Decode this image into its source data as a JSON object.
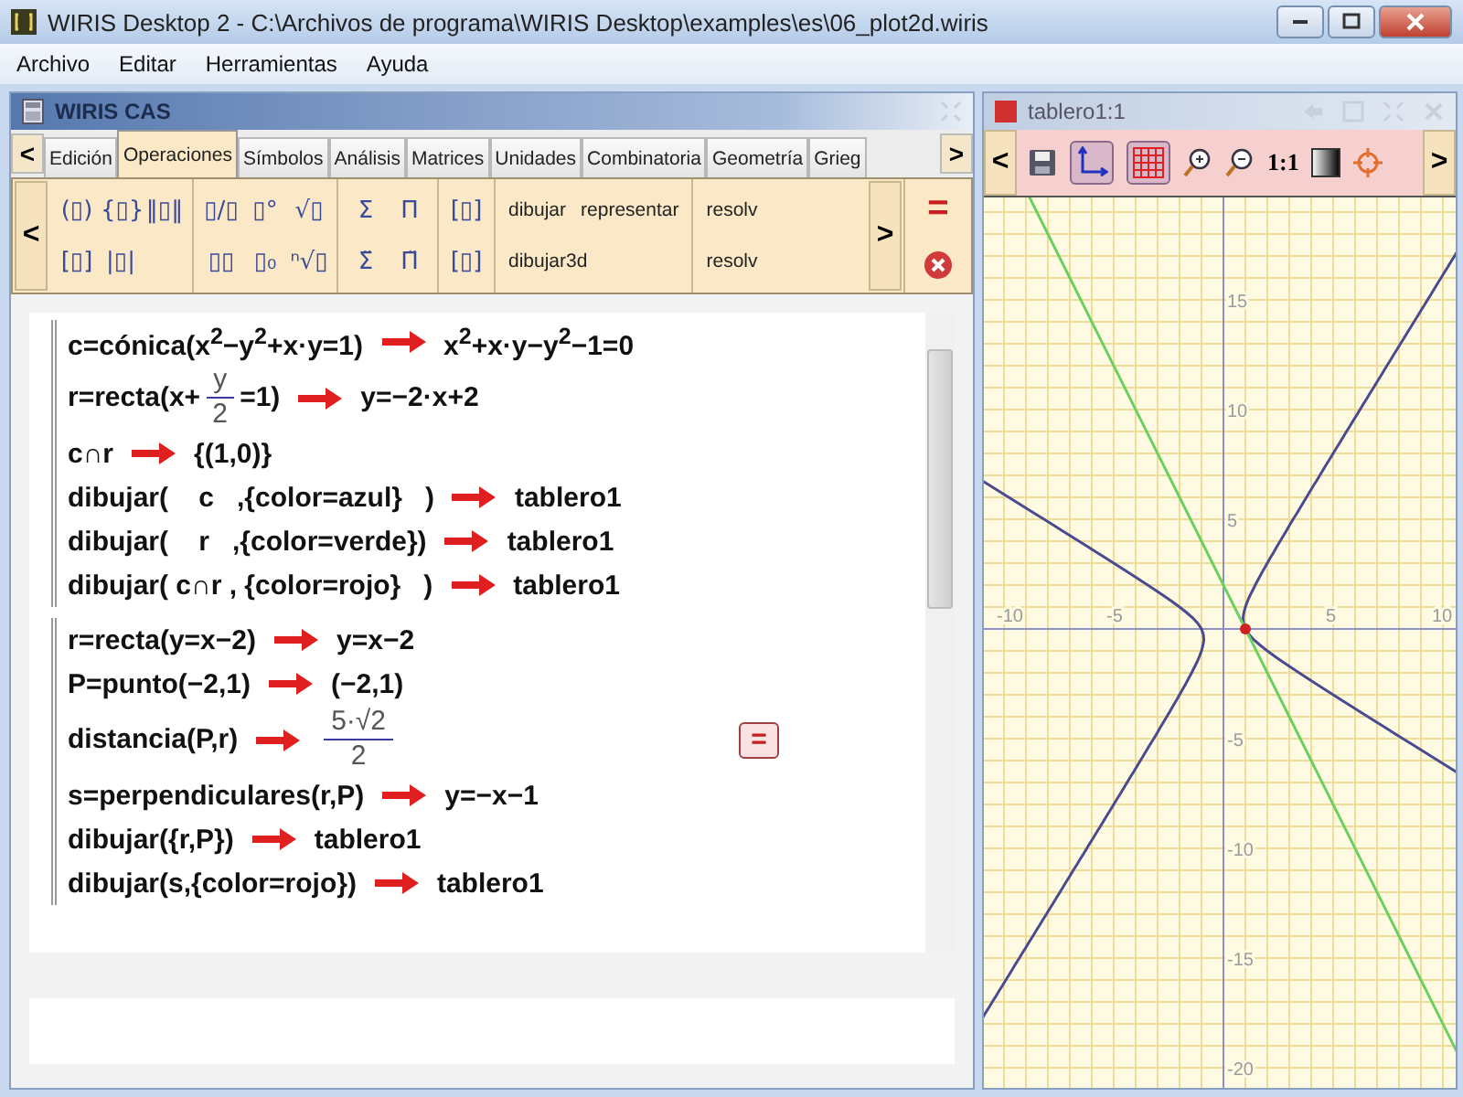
{
  "window": {
    "title": "WIRIS Desktop 2 - C:\\Archivos de programa\\WIRIS Desktop\\examples\\es\\06_plot2d.wiris"
  },
  "menu": [
    "Archivo",
    "Editar",
    "Herramientas",
    "Ayuda"
  ],
  "cas": {
    "title": "WIRIS CAS",
    "tab_prev": "<",
    "tab_next": ">",
    "tabs": [
      {
        "label": "Edición",
        "selected": false
      },
      {
        "label": "Operaciones",
        "selected": true
      },
      {
        "label": "Símbolos",
        "selected": false
      },
      {
        "label": "Análisis",
        "selected": false
      },
      {
        "label": "Matrices",
        "selected": false
      },
      {
        "label": "Unidades",
        "selected": false
      },
      {
        "label": "Combinatoria",
        "selected": false
      },
      {
        "label": "Geometría",
        "selected": false
      },
      {
        "label": "Grieg",
        "selected": false
      }
    ],
    "toolbar": {
      "prev": "<",
      "next": ">",
      "calc": "=",
      "groups": [
        {
          "kind": "symbols",
          "rows": [
            [
              "(▯)",
              "{▯}",
              "‖▯‖"
            ],
            [
              "[▯]",
              "|▯|"
            ]
          ]
        },
        {
          "kind": "symbols",
          "rows": [
            [
              "▯/▯",
              "▯°",
              "√▯"
            ],
            [
              "▯▯",
              "▯₀",
              "ⁿ√▯"
            ]
          ]
        },
        {
          "kind": "symbols",
          "rows": [
            [
              "Σ",
              "Π"
            ],
            [
              "Σ̈",
              "Π̈"
            ]
          ]
        },
        {
          "kind": "symbols",
          "rows": [
            [
              "[▯]"
            ],
            [
              "[▯]"
            ]
          ]
        },
        {
          "kind": "words",
          "rows": [
            [
              "dibujar",
              "representar"
            ],
            [
              "dibujar3d"
            ]
          ]
        },
        {
          "kind": "words",
          "rows": [
            [
              "resolv"
            ],
            [
              "resolv"
            ]
          ]
        }
      ]
    },
    "blocks": [
      {
        "lines": [
          {
            "input": [
              {
                "kind": "text",
                "text": "c=cónica(x$^{2}$−y$^{2}$+x·y=1)"
              }
            ],
            "output": [
              {
                "kind": "text",
                "text": "x$^{2}$+x·y−y$^{2}$−1=0"
              }
            ]
          },
          {
            "input": [
              {
                "kind": "text",
                "text": "r=recta(x+"
              },
              {
                "kind": "frac",
                "num": "y",
                "den": "2"
              },
              {
                "kind": "text",
                "text": "=1)"
              }
            ],
            "output": [
              {
                "kind": "text",
                "text": "y=−2·x+2"
              }
            ]
          },
          {
            "input": [
              {
                "kind": "text",
                "text": "c∩r"
              }
            ],
            "output": [
              {
                "kind": "text",
                "text": "{(1,0)}"
              }
            ]
          },
          {
            "input": [
              {
                "kind": "text",
                "text": "dibujar(    c   ,{color=azul}   )"
              }
            ],
            "output": [
              {
                "kind": "text",
                "text": "tablero1"
              }
            ]
          },
          {
            "input": [
              {
                "kind": "text",
                "text": "dibujar(    r   ,{color=verde})"
              }
            ],
            "output": [
              {
                "kind": "text",
                "text": "tablero1"
              }
            ]
          },
          {
            "input": [
              {
                "kind": "text",
                "text": "dibujar( c∩r , {color=rojo}   )"
              }
            ],
            "output": [
              {
                "kind": "text",
                "text": "tablero1"
              }
            ]
          }
        ]
      },
      {
        "lines": [
          {
            "input": [
              {
                "kind": "text",
                "text": "r=recta(y=x−2)"
              }
            ],
            "output": [
              {
                "kind": "text",
                "text": "y=x−2"
              }
            ]
          },
          {
            "input": [
              {
                "kind": "text",
                "text": "P=punto(−2,1)"
              }
            ],
            "output": [
              {
                "kind": "text",
                "text": "(−2,1)"
              }
            ]
          },
          {
            "input": [
              {
                "kind": "text",
                "text": "distancia(P,r)"
              }
            ],
            "output": [
              {
                "kind": "frac",
                "num": "5·√2",
                "den": "2"
              }
            ],
            "button": "="
          },
          {
            "input": [
              {
                "kind": "text",
                "text": "s=perpendiculares(r,P)"
              }
            ],
            "output": [
              {
                "kind": "text",
                "text": "y=−x−1"
              }
            ]
          },
          {
            "input": [
              {
                "kind": "text",
                "text": "dibujar({r,P})"
              }
            ],
            "output": [
              {
                "kind": "text",
                "text": "tablero1"
              }
            ]
          },
          {
            "input": [
              {
                "kind": "text",
                "text": "dibujar(s,{color=rojo})"
              }
            ],
            "output": [
              {
                "kind": "text",
                "text": "tablero1"
              }
            ]
          }
        ]
      }
    ]
  },
  "board": {
    "title": "tablero1:1",
    "prev": "<",
    "next": ">",
    "zoom_ratio": "1:1",
    "axes_selected": true,
    "grid_selected": true,
    "x_tick_labels": [
      "-10",
      "-5",
      "5",
      "10"
    ],
    "y_tick_labels": [
      "15",
      "10",
      "5",
      "-5",
      "-10",
      "-15",
      "-20"
    ]
  }
}
